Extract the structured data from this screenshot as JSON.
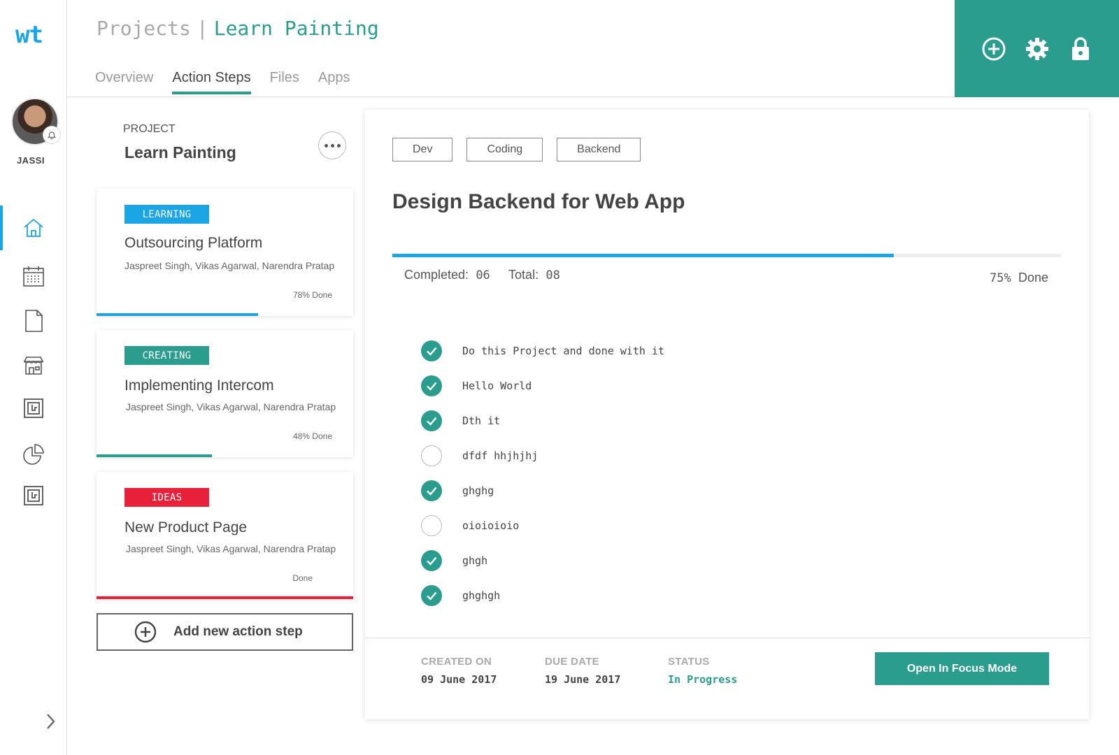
{
  "app": {
    "logo": "wt"
  },
  "user": {
    "name": "JASSI"
  },
  "sidebar": {
    "items": [
      {
        "icon": "home-icon",
        "active": true
      },
      {
        "icon": "calendar-icon",
        "active": false
      },
      {
        "icon": "document-icon",
        "active": false
      },
      {
        "icon": "store-icon",
        "active": false
      },
      {
        "icon": "app-box-icon",
        "active": false
      },
      {
        "icon": "pie-chart-icon",
        "active": false
      },
      {
        "icon": "app-box-icon",
        "active": false
      }
    ]
  },
  "header": {
    "breadcrumb_root": "Projects",
    "breadcrumb_separator": "|",
    "breadcrumb_current": "Learn Painting",
    "tabs": [
      {
        "label": "Overview",
        "active": false
      },
      {
        "label": "Action Steps",
        "active": true
      },
      {
        "label": "Files",
        "active": false
      },
      {
        "label": "Apps",
        "active": false
      }
    ],
    "actions": [
      "add-circle-icon",
      "gear-icon",
      "lock-icon"
    ]
  },
  "project": {
    "label": "PROJECT",
    "name": "Learn Painting"
  },
  "cards": [
    {
      "tag": "LEARNING",
      "tag_color": "#1aa6e4",
      "title": "Outsourcing Platform",
      "members": "Jaspreet Singh, Vikas Agarwal, Narendra Pratap",
      "done_text": "78% Done",
      "progress": 0.63,
      "bar_color": "#1aa6e4"
    },
    {
      "tag": "CREATING",
      "tag_color": "#2a9d8f",
      "title": "Implementing Intercom",
      "members": "Jaspreet Singh, Vikas Agarwal, Narendra Pratap",
      "done_text": "48% Done",
      "progress": 0.45,
      "bar_color": "#2a9d8f"
    },
    {
      "tag": "IDEAS",
      "tag_color": "#e8203a",
      "title": "New Product Page",
      "members": "Jaspreet Singh, Vikas Agarwal, Narendra Pratap",
      "done_text": "Done",
      "progress": 1.0,
      "bar_color": "#e8203a"
    }
  ],
  "add_step": {
    "label": "Add new action step"
  },
  "detail": {
    "chips": [
      "Dev",
      "Coding",
      "Backend"
    ],
    "title": "Design Backend for Web App",
    "progress": 0.75,
    "completed_label": "Completed:",
    "completed_value": "06",
    "total_label": "Total:",
    "total_value": "08",
    "percent_value": "75%",
    "percent_label": "Done",
    "steps": [
      {
        "text": "Do this Project and done with it",
        "done": true
      },
      {
        "text": "Hello World",
        "done": true
      },
      {
        "text": "Dth it",
        "done": true
      },
      {
        "text": "dfdf hhjhjhj",
        "done": false
      },
      {
        "text": "ghghg",
        "done": true
      },
      {
        "text": "oioioioio",
        "done": false
      },
      {
        "text": "ghgh",
        "done": true
      },
      {
        "text": "ghghgh",
        "done": true
      }
    ],
    "created_label": "CREATED ON",
    "created_value": "09 June 2017",
    "due_label": "DUE DATE",
    "due_value": "19 June 2017",
    "status_label": "STATUS",
    "status_value": "In Progress",
    "focus_button": "Open In Focus Mode"
  },
  "colors": {
    "accent": "#2a9d8f",
    "blue": "#1aa6e4",
    "red": "#e8203a"
  }
}
